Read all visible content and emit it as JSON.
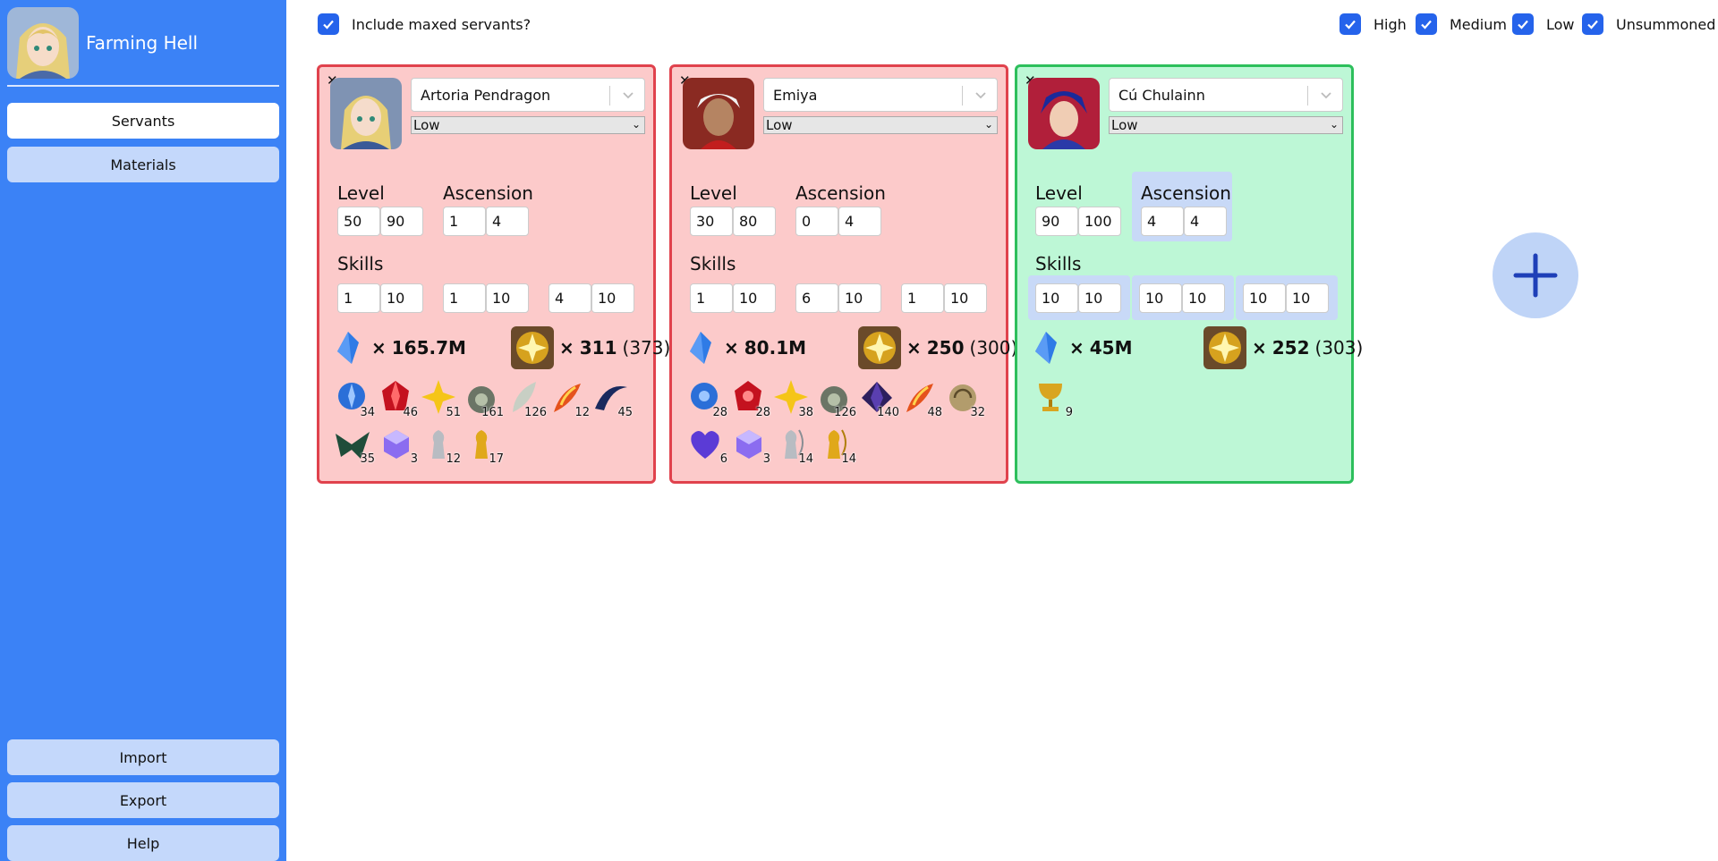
{
  "app": {
    "title": "Farming Hell"
  },
  "sidebar": {
    "nav": [
      {
        "label": "Servants",
        "active": true
      },
      {
        "label": "Materials",
        "active": false
      }
    ],
    "bottom": [
      {
        "label": "Import"
      },
      {
        "label": "Export"
      },
      {
        "label": "Help"
      }
    ]
  },
  "filters": {
    "include_maxed": {
      "label": "Include maxed servants?",
      "checked": true
    },
    "priorities": [
      {
        "label": "High",
        "checked": true
      },
      {
        "label": "Medium",
        "checked": true
      },
      {
        "label": "Low",
        "checked": true
      },
      {
        "label": "Unsummoned",
        "checked": true
      }
    ]
  },
  "labels": {
    "level": "Level",
    "ascension": "Ascension",
    "skills": "Skills"
  },
  "servants": [
    {
      "name": "Artoria Pendragon",
      "priority": "Low",
      "status_color": "#fccaca",
      "level": {
        "current": "50",
        "target": "90"
      },
      "ascension": {
        "current": "1",
        "target": "4"
      },
      "skills": [
        {
          "current": "1",
          "target": "10"
        },
        {
          "current": "1",
          "target": "10"
        },
        {
          "current": "4",
          "target": "10"
        }
      ],
      "qp": "165.7M",
      "rare": {
        "count": "311",
        "total": "(373)"
      },
      "materials": [
        "34",
        "46",
        "51",
        "161",
        "126",
        "12",
        "45",
        "35",
        "3",
        "12",
        "17"
      ]
    },
    {
      "name": "Emiya",
      "priority": "Low",
      "status_color": "#fccaca",
      "level": {
        "current": "30",
        "target": "80"
      },
      "ascension": {
        "current": "0",
        "target": "4"
      },
      "skills": [
        {
          "current": "1",
          "target": "10"
        },
        {
          "current": "6",
          "target": "10"
        },
        {
          "current": "1",
          "target": "10"
        }
      ],
      "qp": "80.1M",
      "rare": {
        "count": "250",
        "total": "(300)"
      },
      "materials": [
        "28",
        "28",
        "38",
        "126",
        "140",
        "48",
        "32",
        "6",
        "3",
        "14",
        "14"
      ]
    },
    {
      "name": "Cú Chulainn",
      "priority": "Low",
      "status_color": "#bdf7d6",
      "level": {
        "current": "90",
        "target": "100"
      },
      "ascension": {
        "current": "4",
        "target": "4"
      },
      "skills": [
        {
          "current": "10",
          "target": "10"
        },
        {
          "current": "10",
          "target": "10"
        },
        {
          "current": "10",
          "target": "10"
        }
      ],
      "qp": "45M",
      "rare": {
        "count": "252",
        "total": "(303)"
      },
      "materials": [
        "9"
      ]
    }
  ],
  "qp_prefix": "×",
  "colors": {
    "sidebar": "#3b82f6",
    "accent": "#2563eb",
    "card_red_border": "#e0424d",
    "card_green_border": "#2dbf5c"
  }
}
